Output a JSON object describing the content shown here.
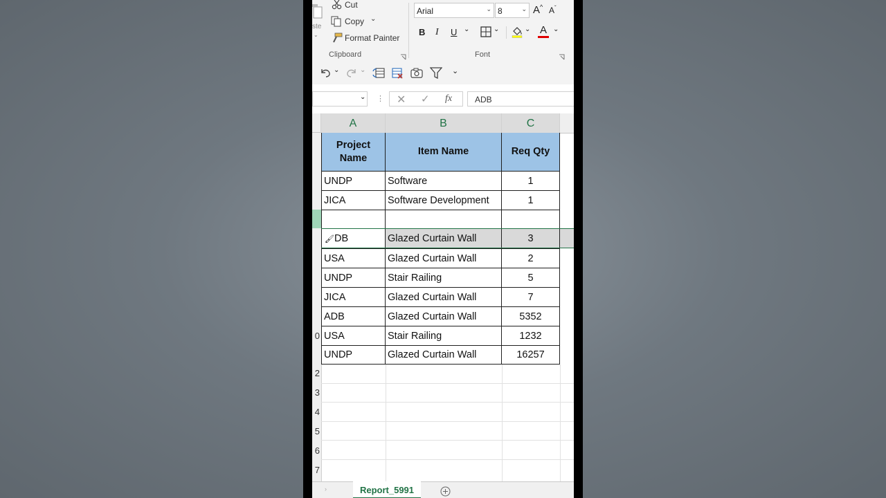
{
  "ribbon": {
    "clipboard": {
      "cut_label": "Cut",
      "copy_label": "Copy",
      "format_painter_label": "Format Painter",
      "paste_label": "ste",
      "group_label": "Clipboard"
    },
    "font": {
      "font_name": "Arial",
      "font_size": "8",
      "bold": "B",
      "italic": "I",
      "underline": "U",
      "font_color_glyph": "A",
      "grow_glyph": "A",
      "shrink_glyph": "A",
      "group_label": "Font"
    }
  },
  "formula_bar": {
    "value": "ADB",
    "fx_label": "fx"
  },
  "grid": {
    "columns": [
      "A",
      "B",
      "C"
    ],
    "row_numbers": [
      "0",
      "2",
      "3",
      "4",
      "5",
      "6",
      "7"
    ],
    "header": {
      "project_name": "Project Name",
      "item_name": "Item Name",
      "req_qty": "Req Qty"
    },
    "rows": [
      {
        "project": "UNDP",
        "item": "Software",
        "qty": "1"
      },
      {
        "project": "JICA",
        "item": "Software Development",
        "qty": "1"
      },
      {
        "project": "",
        "item": "",
        "qty": ""
      },
      {
        "project": "DB",
        "item": "Glazed Curtain Wall",
        "qty": "3"
      },
      {
        "project": "USA",
        "item": "Glazed Curtain Wall",
        "qty": "2"
      },
      {
        "project": "UNDP",
        "item": "Stair Railing",
        "qty": "5"
      },
      {
        "project": "JICA",
        "item": "Glazed Curtain Wall",
        "qty": "7"
      },
      {
        "project": "ADB",
        "item": "Glazed Curtain Wall",
        "qty": "5352"
      },
      {
        "project": "USA",
        "item": "Stair Railing",
        "qty": "1232"
      },
      {
        "project": "UNDP",
        "item": "Glazed Curtain Wall",
        "qty": "16257"
      }
    ]
  },
  "sheet_tabs": {
    "active": "Report_5991"
  },
  "colors": {
    "accent_green": "#217346",
    "header_fill": "#9dc3e6"
  }
}
